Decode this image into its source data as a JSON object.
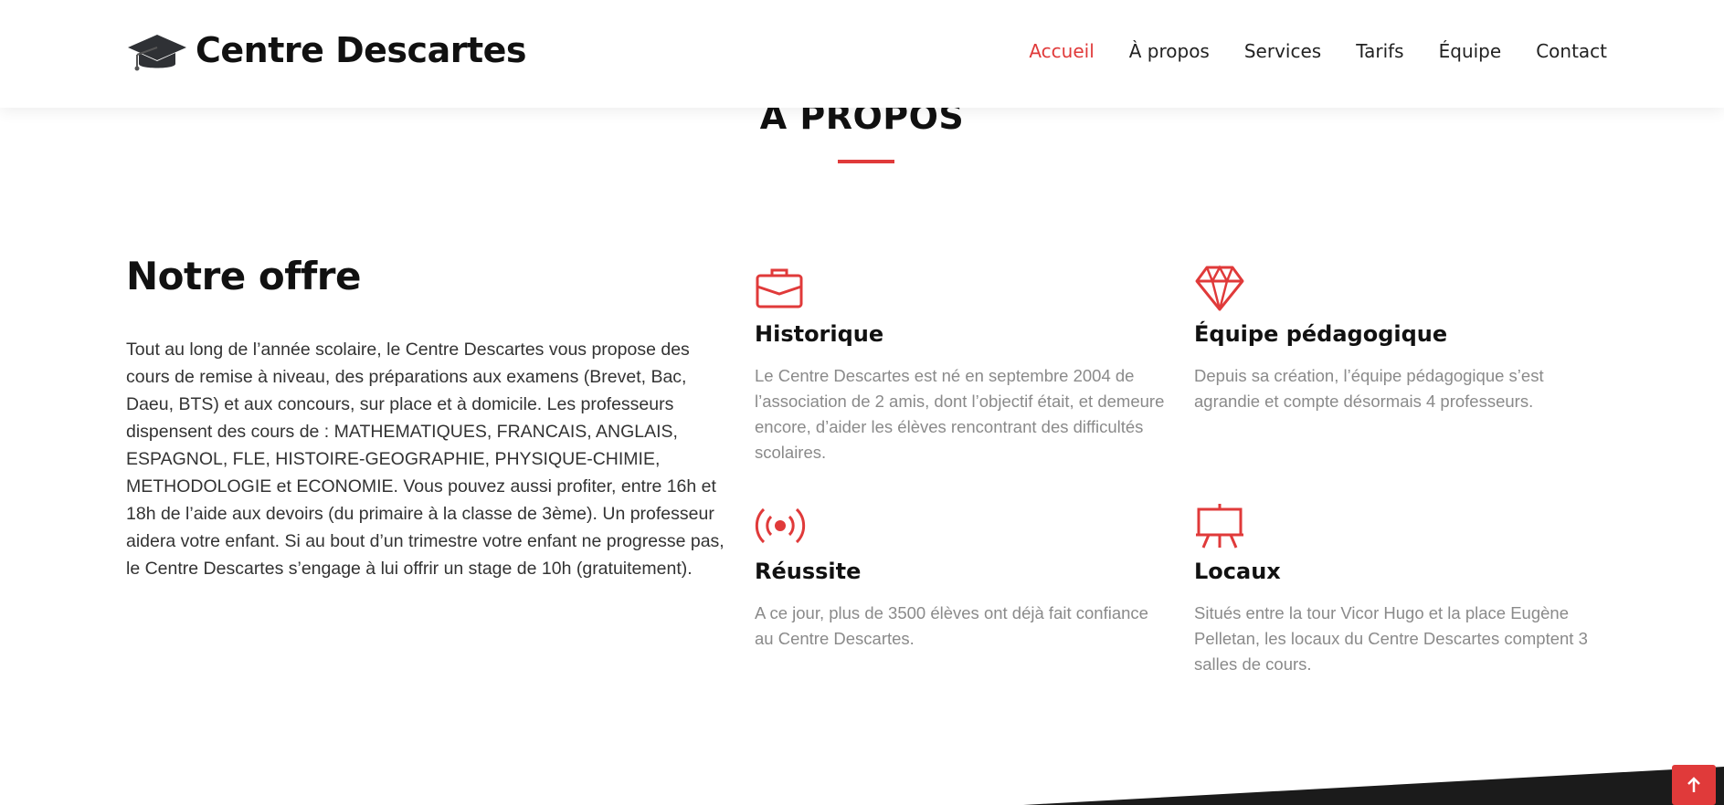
{
  "header": {
    "brand": "Centre Descartes",
    "logo_icon": "graduation-cap-icon",
    "nav": [
      {
        "label": "Accueil",
        "active": true
      },
      {
        "label": "À propos",
        "active": false
      },
      {
        "label": "Services",
        "active": false
      },
      {
        "label": "Tarifs",
        "active": false
      },
      {
        "label": "Équipe",
        "active": false
      },
      {
        "label": "Contact",
        "active": false
      }
    ]
  },
  "section": {
    "title": "À PROPOS"
  },
  "offer": {
    "title": "Notre offre",
    "text": "Tout au long de l’année scolaire, le Centre Descartes vous propose des cours de remise à niveau, des préparations aux examens (Brevet, Bac, Daeu, BTS) et aux concours, sur place et à domicile. Les professeurs dispensent des cours de : MATHEMATIQUES, FRANCAIS, ANGLAIS, ESPAGNOL, FLE, HISTOIRE-GEOGRAPHIE, PHYSIQUE-CHIMIE, METHODOLOGIE et ECONOMIE. Vous pouvez aussi profiter, entre 16h et 18h de l’aide aux devoirs (du primaire à la classe de 3ème). Un professeur aidera votre enfant. Si au bout d’un trimestre votre enfant ne progresse pas, le Centre Descartes s’engage à lui offrir un stage de 10h (gratuitement)."
  },
  "features": [
    {
      "icon": "briefcase-icon",
      "title": "Historique",
      "text": "Le Centre Descartes est né en septembre 2004 de l’association de 2 amis, dont l’objectif était, et demeure encore, d’aider les élèves rencontrant des difficultés scolaires."
    },
    {
      "icon": "diamond-icon",
      "title": "Équipe pédagogique",
      "text": "Depuis sa création, l’équipe pédagogique s’est agrandie et compte désormais 4 professeurs."
    },
    {
      "icon": "broadcast-icon",
      "title": "Réussite",
      "text": "A ce jour, plus de 3500 élèves ont déjà fait confiance au Centre Descartes."
    },
    {
      "icon": "easel-icon",
      "title": "Locaux",
      "text": "Situés entre la tour Vicor Hugo et la place Eugène Pelletan, les locaux du Centre Descartes comptent 3 salles de cours."
    }
  ],
  "back_to_top_icon": "arrow-up-icon",
  "colors": {
    "accent": "#e03a3a",
    "heading": "#111111",
    "body_text": "#333333",
    "muted_text": "#8a8a8a",
    "footer_dark": "#1b1b1b"
  }
}
